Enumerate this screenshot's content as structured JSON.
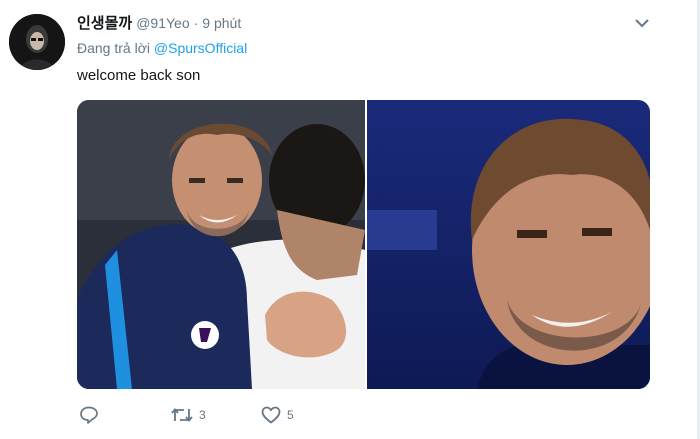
{
  "tweet": {
    "author_name": "인생몰까",
    "handle": "@91Yeo",
    "separator": "·",
    "time": "9 phút",
    "reply_prefix": "Đang trả lời",
    "reply_to": "@SpursOfficial",
    "text": "welcome back son"
  },
  "actions": {
    "reply_count": "",
    "retweet_count": "3",
    "like_count": "5"
  },
  "icons": {
    "more": "chevron-down-icon",
    "reply": "reply-icon",
    "retweet": "retweet-icon",
    "like": "heart-icon"
  },
  "colors": {
    "link": "#1da1f2",
    "secondary_text": "#657786",
    "primary_text": "#14171a"
  }
}
